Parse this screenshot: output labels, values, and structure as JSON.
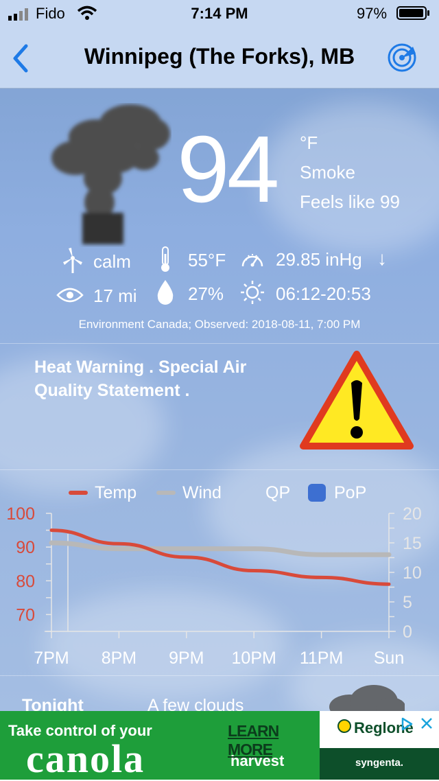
{
  "status_bar": {
    "carrier": "Fido",
    "time": "7:14 PM",
    "battery": "97%",
    "battery_level": 0.97
  },
  "nav": {
    "title": "Winnipeg (The Forks), MB",
    "back_icon": "chevron-left-icon",
    "radar_icon": "radar-icon"
  },
  "current": {
    "temperature": "94",
    "unit": "°F",
    "condition": "Smoke",
    "feels_like": "Feels like 99",
    "wind": "calm",
    "dewpoint": "55°F",
    "pressure": "29.85 inHg",
    "pressure_trend": "↓",
    "visibility": "17 mi",
    "humidity": "27%",
    "sun": "06:12-20:53",
    "source": "Environment Canada; Observed: 2018-08-11, 7:00 PM"
  },
  "warning": {
    "text": "Heat Warning . Special Air Quality Statement ."
  },
  "chart_data": {
    "type": "line",
    "legend": [
      {
        "name": "Temp",
        "color": "#d84a3a"
      },
      {
        "name": "Wind",
        "color": "#b8b8b8"
      },
      {
        "name": "QP",
        "color": ""
      },
      {
        "name": "PoP",
        "color": "#3d6fd1"
      }
    ],
    "categories": [
      "7PM",
      "8PM",
      "9PM",
      "10PM",
      "11PM",
      "Sun"
    ],
    "series": [
      {
        "name": "Temp",
        "axis": "left",
        "color": "#d84a3a",
        "values": [
          95,
          91,
          87,
          83,
          81,
          79
        ]
      },
      {
        "name": "Wind",
        "axis": "right",
        "color": "#b8b8b8",
        "values": [
          15,
          14,
          14,
          14,
          13,
          13
        ]
      }
    ],
    "y_left": {
      "ticks": [
        70,
        80,
        90,
        100
      ],
      "range": [
        65,
        100
      ],
      "color": "#d84a3a"
    },
    "y_right": {
      "ticks": [
        0,
        5,
        10,
        15,
        20
      ],
      "range": [
        0,
        20
      ],
      "color": "#e6e6e6"
    }
  },
  "forecast_peek": {
    "label": "Tonight",
    "text": "A few clouds"
  },
  "ad": {
    "line1": "Take control of your",
    "brand": "canola",
    "line2": "harvest",
    "cta": "LEARN MORE",
    "product": "Reglone",
    "company": "syngenta.",
    "adchoices_icon": "adchoices-icon",
    "close_icon": "close-icon",
    "colors": {
      "green": "#1e9e3a",
      "dark_green": "#0d4f2a",
      "yellow": "#ffd400"
    }
  }
}
